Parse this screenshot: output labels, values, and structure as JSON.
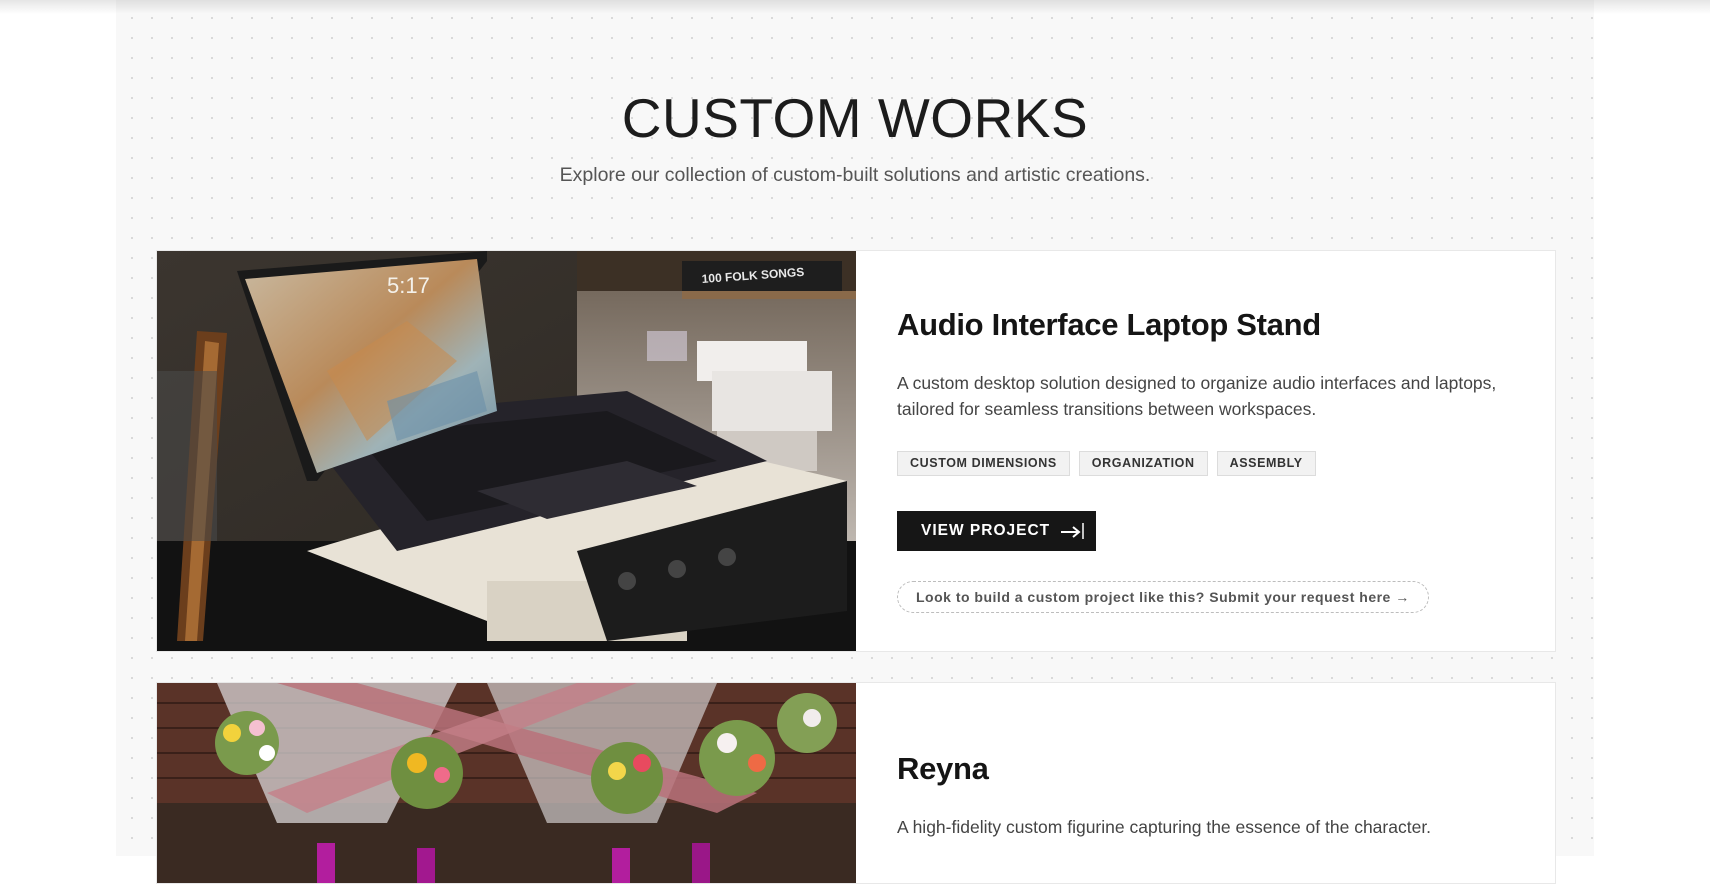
{
  "hero": {
    "title": "CUSTOM WORKS",
    "subtitle": "Explore our collection of custom-built solutions and artistic creations."
  },
  "projects": [
    {
      "title": "Audio Interface Laptop Stand",
      "description": "A custom desktop solution designed to organize audio interfaces and laptops, tailored for seamless transitions between workspaces.",
      "tags": [
        "CUSTOM DIMENSIONS",
        "ORGANIZATION",
        "ASSEMBLY"
      ],
      "button_label": "VIEW PROJECT",
      "button_icon": "arrow-right-icon",
      "request_text": "Look to build a custom project like this? Submit your request here →",
      "image": {
        "alt": "Laptop on a custom stand",
        "screen_time": "5:17",
        "book_title": "100 FOLK SONGS"
      }
    },
    {
      "title": "Reyna",
      "description": "A high-fidelity custom figurine capturing the essence of the character.",
      "image": {
        "alt": "Floral arrangements with candles"
      }
    }
  ],
  "colors": {
    "accent": "#161616",
    "page_background": "#f8f8f8",
    "card_background": "#ffffff",
    "text_muted": "#444444"
  }
}
